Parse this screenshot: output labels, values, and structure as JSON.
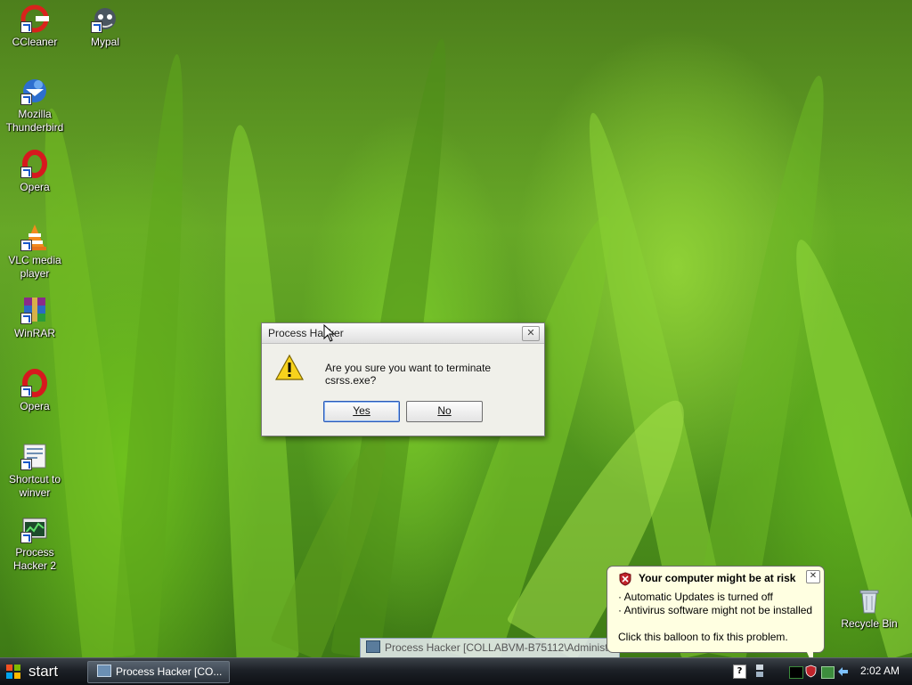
{
  "desktop": {
    "icons": [
      {
        "label": "CCleaner",
        "icon": "ccleaner-icon"
      },
      {
        "label": "Mypal",
        "icon": "mypal-icon"
      },
      {
        "label": "Mozilla Thunderbird",
        "icon": "thunderbird-icon"
      },
      {
        "label": "Opera",
        "icon": "opera-icon"
      },
      {
        "label": "VLC media player",
        "icon": "vlc-icon"
      },
      {
        "label": "WinRAR",
        "icon": "winrar-icon"
      },
      {
        "label": "Opera",
        "icon": "opera-icon"
      },
      {
        "label": "Shortcut to winver",
        "icon": "winver-icon"
      },
      {
        "label": "Process Hacker 2",
        "icon": "process-hacker-icon"
      },
      {
        "label": "Recycle Bin",
        "icon": "recycle-bin-icon"
      }
    ]
  },
  "dialog": {
    "title": "Process Hacker",
    "message": "Are you sure you want to terminate csrss.exe?",
    "yes_label": "Yes",
    "no_label": "No",
    "close_glyph": "✕"
  },
  "balloon": {
    "title": "Your computer might be at risk",
    "lines": [
      "· Automatic Updates is turned off",
      "· Antivirus software might not be installed"
    ],
    "footer": "Click this balloon to fix this problem.",
    "close_glyph": "✕"
  },
  "ghost_window": {
    "title": "Process Hacker [COLLABVM-B75112\\Administra"
  },
  "taskbar": {
    "start_label": "start",
    "task_label": "Process Hacker [CO...",
    "help_glyph": "?",
    "clock": "2:02 AM"
  },
  "colors": {
    "accent": "#2b58b5",
    "warning": "#f7d21c",
    "balloon_bg": "#ffffe1",
    "shield_red": "#c0242b"
  }
}
